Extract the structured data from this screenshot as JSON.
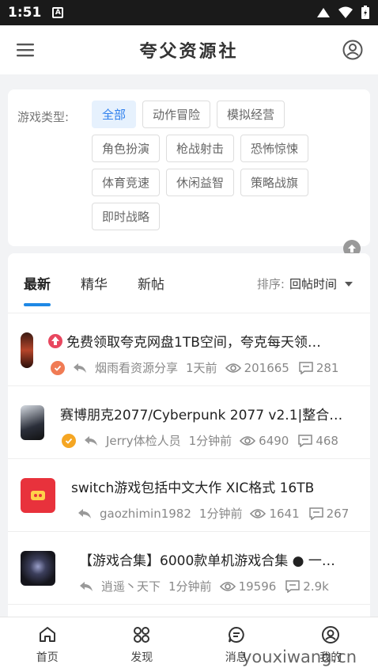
{
  "status_bar": {
    "time": "1:51",
    "notif": "A"
  },
  "header": {
    "title": "夸父资源社"
  },
  "filter": {
    "label": "游戏类型:",
    "tags": [
      "全部",
      "动作冒险",
      "模拟经营",
      "角色扮演",
      "枪战射击",
      "恐怖惊悚",
      "体育竞速",
      "休闲益智",
      "策略战旗",
      "即时战略"
    ]
  },
  "tabs": [
    "最新",
    "精华",
    "新帖"
  ],
  "sort": {
    "label": "排序:",
    "value": "回帖时间"
  },
  "posts": [
    {
      "title": "免费领取夸克网盘1TB空间，夸克每天领…",
      "author": "烟雨看资源分享",
      "time": "1天前",
      "views": "201665",
      "comments": "281"
    },
    {
      "title": "赛博朋克2077/Cyberpunk 2077 v2.1|整合…",
      "author": "Jerry体检人员",
      "time": "1分钟前",
      "views": "6490",
      "comments": "468"
    },
    {
      "title": "switch游戏包括中文大作 XIC格式 16TB",
      "author": "gaozhimin1982",
      "time": "1分钟前",
      "views": "1641",
      "comments": "267"
    },
    {
      "title": "【游戏合集】6000款单机游戏合集 ● 一…",
      "author": "逍遥丶天下",
      "time": "1分钟前",
      "views": "19596",
      "comments": "2.9k"
    }
  ],
  "nav": [
    "首页",
    "发现",
    "消息",
    "我的"
  ],
  "watermark": "youxiwang.cn",
  "colors": {
    "accent": "#1e88e5",
    "active_tag_bg": "#e6f1fd",
    "active_tag_text": "#2f80ed"
  }
}
